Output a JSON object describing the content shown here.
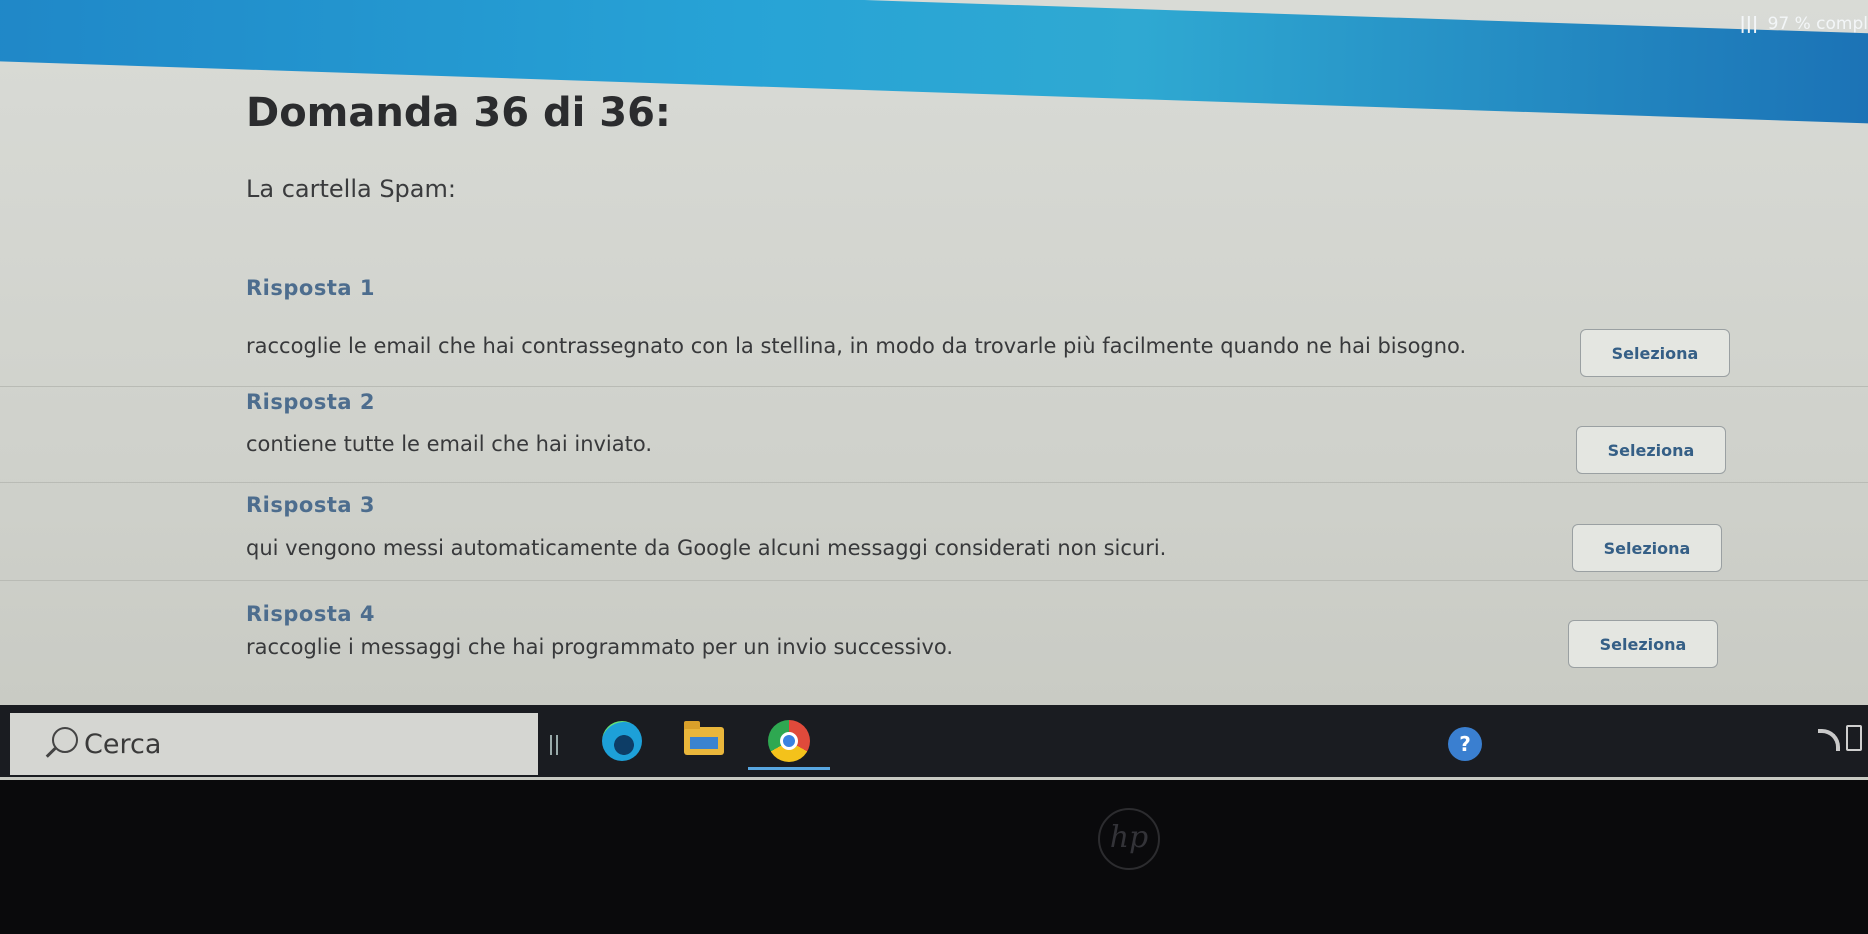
{
  "progress": {
    "text": "97 % compl",
    "percent": 97
  },
  "quiz": {
    "title": "Domanda 36 di 36:",
    "question": "La cartella Spam:",
    "answers": [
      {
        "label": "Risposta 1",
        "text": "raccoglie le email che hai contrassegnato con la stellina, in modo da trovarle più facilmente quando ne hai bisogno.",
        "button": "Seleziona"
      },
      {
        "label": "Risposta 2",
        "text": "contiene tutte le email che hai inviato.",
        "button": "Seleziona"
      },
      {
        "label": "Risposta 3",
        "text": "qui vengono messi automaticamente da Google alcuni messaggi considerati non sicuri.",
        "button": "Seleziona"
      },
      {
        "label": "Risposta 4",
        "text": "raccoglie i messaggi che hai programmato per un invio successivo.",
        "button": "Seleziona"
      }
    ]
  },
  "taskbar": {
    "search_placeholder": "Cerca",
    "apps": [
      "edge-icon",
      "file-explorer-icon",
      "chrome-icon"
    ],
    "tray": [
      "help-icon",
      "wifi-icon",
      "battery-icon"
    ]
  },
  "colors": {
    "accent": "#355f86",
    "progress": "#27a3d6",
    "taskbar": "#1a1c21"
  }
}
